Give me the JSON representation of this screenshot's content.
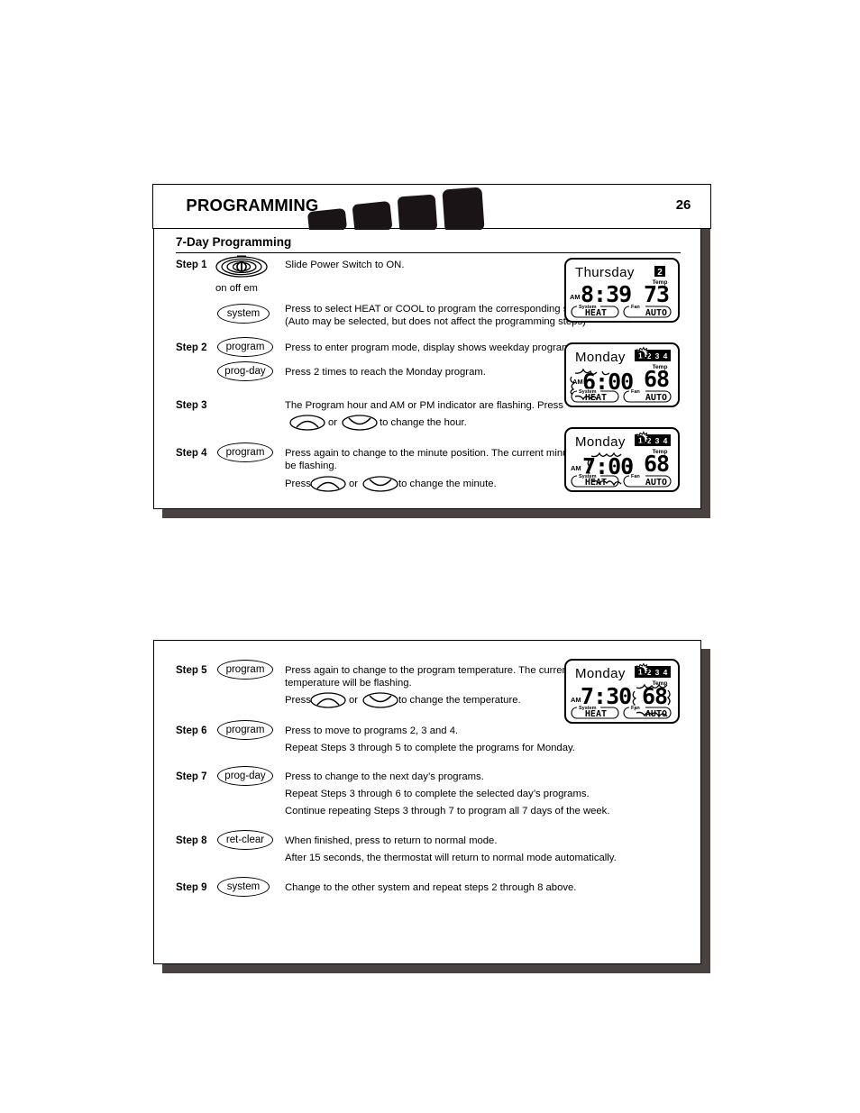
{
  "document": {
    "header": {
      "title": "PROGRAMMING",
      "page_number": "26"
    },
    "section_title": "7-Day Programming"
  },
  "steps": [
    {
      "id": "step-1",
      "label": "Step 1",
      "controls": [
        {
          "type": "power-switch",
          "icon": "power-switch-icon",
          "legend": "on  off  em"
        },
        {
          "type": "ellipse-button",
          "label": "system"
        }
      ],
      "texts": [
        "Slide Power Switch to ON.",
        "Press to select HEAT or COOL to program the corresponding system.\n(Auto may be selected, but does not affect the programming steps)"
      ]
    },
    {
      "id": "step-2",
      "label": "Step 2",
      "controls": [
        {
          "type": "ellipse-button",
          "label": "program"
        },
        {
          "type": "ellipse-button",
          "label": "prog-day"
        }
      ],
      "texts": [
        "Press to enter program mode, display shows weekday programs.",
        "Press 2 times to reach the Monday program."
      ]
    },
    {
      "id": "step-3",
      "label": "Step 3",
      "controls": [],
      "texts": [
        "The Program hour and AM or PM indicator are flashing. Press",
        "or",
        "to change the hour."
      ]
    },
    {
      "id": "step-4",
      "label": "Step 4",
      "controls": [
        {
          "type": "ellipse-button",
          "label": "program"
        }
      ],
      "texts": [
        "Press again to change to the minute position. The current minute will\nbe flashing.",
        "Press",
        "or",
        "to change the minute."
      ]
    },
    {
      "id": "step-5",
      "label": "Step 5",
      "controls": [
        {
          "type": "ellipse-button",
          "label": "program"
        }
      ],
      "texts": [
        "Press again to change to the program temperature. The current\ntemperature will be flashing.",
        "Press",
        "or",
        "to change the temperature."
      ]
    },
    {
      "id": "step-6",
      "label": "Step 6",
      "controls": [
        {
          "type": "ellipse-button",
          "label": "program"
        }
      ],
      "texts": [
        "Press to move to programs 2, 3 and 4.",
        "Repeat Steps 3 through 5 to complete the programs for Monday."
      ]
    },
    {
      "id": "step-7",
      "label": "Step 7",
      "controls": [
        {
          "type": "ellipse-button",
          "label": "prog-day"
        }
      ],
      "texts": [
        "Press to change to the next day’s programs.",
        "Repeat Steps 3 through 6 to complete the selected day’s programs.",
        "Continue repeating Steps 3 through 7 to program all 7 days of the week."
      ]
    },
    {
      "id": "step-8",
      "label": "Step 8",
      "controls": [
        {
          "type": "ellipse-button",
          "label": "ret-clear"
        }
      ],
      "texts": [
        "When finished, press to return to normal mode.",
        "After 15 seconds, the thermostat will return to normal mode automatically."
      ]
    },
    {
      "id": "step-9",
      "label": "Step 9",
      "controls": [
        {
          "type": "ellipse-button",
          "label": "system"
        }
      ],
      "texts": [
        "Change to the other system and repeat steps 2 through 8 above."
      ]
    }
  ],
  "displays": [
    {
      "id": "display-thursday",
      "day": "Thursday",
      "program_badge": "2",
      "program_indicators": [],
      "meridiem": "AM",
      "time": "8:39",
      "temp_label": "Temp",
      "temperature": "73",
      "system_label": "System",
      "system_mode": "HEAT",
      "fan_label": "Fan",
      "fan_mode": "AUTO",
      "flashing": "none"
    },
    {
      "id": "display-monday-hour",
      "day": "Monday",
      "program_badge": "",
      "program_indicators": [
        "1",
        "2",
        "3",
        "4"
      ],
      "active_program": "1",
      "meridiem": "AM",
      "time": "6:00",
      "temp_label": "Temp",
      "temperature": "68",
      "system_label": "System",
      "system_mode": "HEAT",
      "fan_label": "Fan",
      "fan_mode": "AUTO",
      "flashing": "hour"
    },
    {
      "id": "display-monday-minute",
      "day": "Monday",
      "program_badge": "",
      "program_indicators": [
        "1",
        "2",
        "3",
        "4"
      ],
      "active_program": "1",
      "meridiem": "AM",
      "time": "7:00",
      "temp_label": "Temp",
      "temperature": "68",
      "system_label": "System",
      "system_mode": "HEAT",
      "fan_label": "Fan",
      "fan_mode": "AUTO",
      "flashing": "minute"
    },
    {
      "id": "display-monday-temp",
      "day": "Monday",
      "program_badge": "",
      "program_indicators": [
        "1",
        "2",
        "3",
        "4"
      ],
      "active_program": "1",
      "meridiem": "AM",
      "time": "7:30",
      "temp_label": "Temp",
      "temperature": "68",
      "system_label": "System",
      "system_mode": "HEAT",
      "fan_label": "Fan",
      "fan_mode": "AUTO",
      "flashing": "temperature"
    }
  ],
  "colors": {
    "ink": "#000000",
    "shadow": "#4a4240",
    "paper": "#ffffff"
  }
}
